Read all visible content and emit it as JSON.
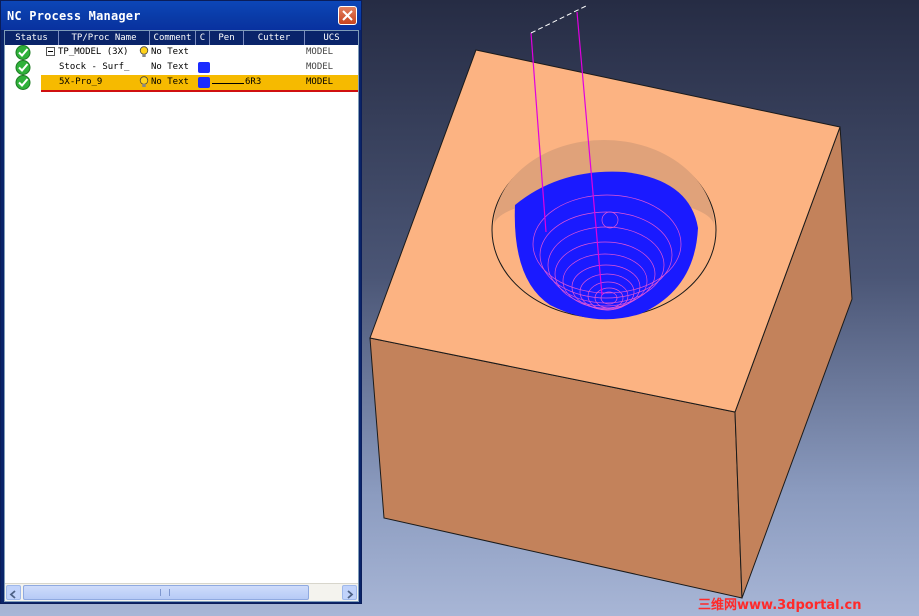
{
  "window": {
    "title": "NC Process Manager",
    "close_icon": "close-icon"
  },
  "columns": [
    "Status",
    "TP/Proc Name",
    "Comment",
    "C",
    "Pen",
    "Cutter",
    "UCS"
  ],
  "rows": [
    {
      "status_icon": "check-icon",
      "name": "TP_MODEL (3X)",
      "comment_icon": "bulb-icon",
      "comment": "No Text",
      "color": "",
      "pen": "",
      "cutter": "",
      "ucs": "MODEL",
      "expanded": true
    },
    {
      "status_icon": "check-icon",
      "name": "Stock - Surf_",
      "comment_icon": "",
      "comment": "No Text",
      "color": "#1a2bff",
      "pen": "",
      "cutter": "",
      "ucs": "MODEL"
    },
    {
      "status_icon": "check-icon",
      "name": "5X-Pro_9",
      "comment_icon": "bulb-icon",
      "comment": "No Text",
      "color": "#1a2bff",
      "pen": "line",
      "cutter": "6R3",
      "ucs": "MODEL",
      "selected": true
    }
  ],
  "colors": {
    "selection": "#f6ba00",
    "block_top": "#fcb382",
    "block_left": "#f7ad7b",
    "block_right": "#c3825b",
    "toolpath": "#1a1aff"
  },
  "watermark": "三维网www.3dportal.cn"
}
